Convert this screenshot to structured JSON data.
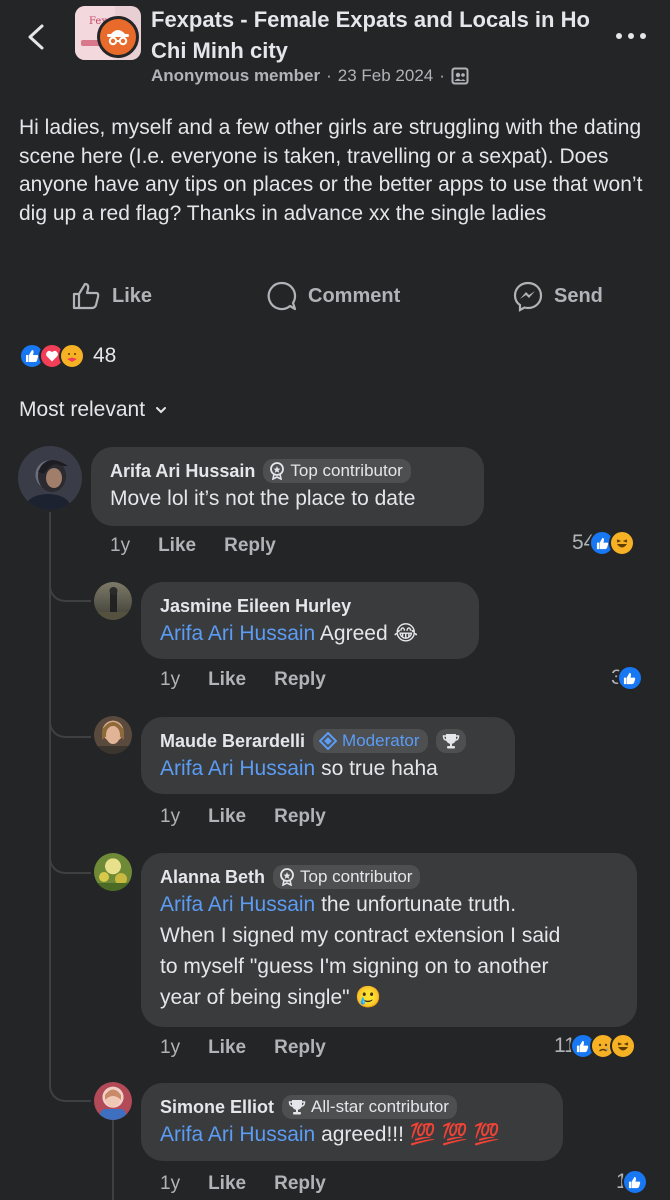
{
  "header": {
    "group_name": "Fexpats - Female Expats and Locals in Ho Chi Minh city",
    "group_avatar_text": "Fex",
    "author": "Anonymous member",
    "separator": "·",
    "date": "23 Feb 2024",
    "privacy_icon": "group-members-icon"
  },
  "post": {
    "text": "Hi ladies, myself and a few other girls are struggling with the dating scene here (I.e. everyone is taken, travelling or a sexpat). Does anyone have any tips on places or the better apps to use that won’t dig up a red flag? Thanks in advance xx the single ladies"
  },
  "actions": {
    "like": "Like",
    "comment": "Comment",
    "send": "Send"
  },
  "reactions": {
    "count": "48",
    "types": [
      "like",
      "love",
      "care"
    ]
  },
  "sort": {
    "label": "Most relevant"
  },
  "comments": [
    {
      "name": "Arifa Ari Hussain",
      "badge": "Top contributor",
      "text": "Move lol it’s not the place to date",
      "time": "1y",
      "like": "Like",
      "reply": "Reply",
      "reaction_count": "54",
      "reactions": [
        "like",
        "haha"
      ]
    },
    {
      "name": "Jasmine Eileen Hurley",
      "mention": "Arifa Ari Hussain",
      "text": " Agreed 😂",
      "time": "1y",
      "like": "Like",
      "reply": "Reply",
      "reaction_count": "3",
      "reactions": [
        "like"
      ]
    },
    {
      "name": "Maude Berardelli",
      "badge": "Moderator",
      "mention": "Arifa Ari Hussain",
      "text": " so true haha",
      "time": "1y",
      "like": "Like",
      "reply": "Reply"
    },
    {
      "name": "Alanna Beth",
      "badge": "Top contributor",
      "mention": "Arifa Ari Hussain",
      "text_line1": " the unfortunate truth.",
      "text_line2": "When I signed my contract extension I said",
      "text_line3": "to myself \"guess I'm signing on to another",
      "text_line4": "year of being single\" 🥲",
      "time": "1y",
      "like": "Like",
      "reply": "Reply",
      "reaction_count": "11",
      "reactions": [
        "like",
        "sad",
        "haha"
      ]
    },
    {
      "name": "Simone Elliot",
      "badge": "All-star contributor",
      "mention": "Arifa Ari Hussain",
      "text": " agreed!!! 💯 💯 💯",
      "time": "1y",
      "like": "Like",
      "reply": "Reply",
      "reaction_count": "1",
      "reactions": [
        "like"
      ]
    }
  ],
  "colors": {
    "background": "#242526",
    "bubble": "#3a3b3c",
    "mention": "#5b9cf5",
    "like_blue": "#1877f2"
  }
}
